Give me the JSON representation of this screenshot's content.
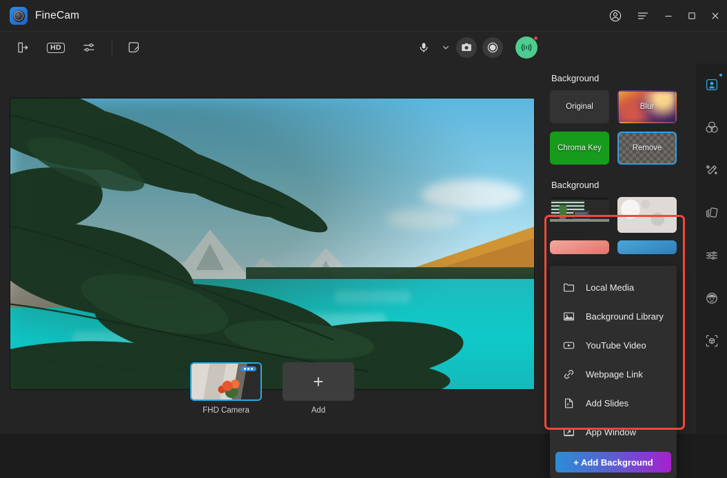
{
  "app": {
    "name": "FineCam"
  },
  "titlebar": {
    "buttons": [
      {
        "name": "account-icon",
        "label": "Account"
      },
      {
        "name": "menu-icon",
        "label": "Menu"
      },
      {
        "name": "minimize-icon",
        "label": "Minimize"
      },
      {
        "name": "maximize-icon",
        "label": "Maximize"
      },
      {
        "name": "close-icon",
        "label": "Close"
      }
    ]
  },
  "toolbar": {
    "left": [
      {
        "name": "output-icon",
        "label": "Virtual Camera Output"
      },
      {
        "name": "hd-badge",
        "label": "HD"
      },
      {
        "name": "adjust-icon",
        "label": "Adjustments"
      },
      {
        "name": "whiteboard-icon",
        "label": "Whiteboard"
      }
    ],
    "right": [
      {
        "name": "microphone-icon",
        "label": "Microphone"
      },
      {
        "name": "chevron-down-icon",
        "label": "Microphone Options"
      },
      {
        "name": "snapshot-icon",
        "label": "Snapshot"
      },
      {
        "name": "record-icon",
        "label": "Record"
      },
      {
        "name": "broadcast-icon",
        "label": "Live"
      }
    ]
  },
  "cameras": {
    "items": [
      {
        "label": "FHD Camera",
        "selected": true,
        "badge": "..."
      },
      {
        "label": "Add",
        "selected": false,
        "badge": ""
      }
    ]
  },
  "panel": {
    "background_title": "Background",
    "modes": [
      {
        "label": "Original",
        "style": "original",
        "selected": false
      },
      {
        "label": "Blur",
        "style": "blur",
        "selected": false
      },
      {
        "label": "Chroma Key",
        "style": "chroma",
        "selected": false
      },
      {
        "label": "Remove",
        "style": "remove",
        "selected": true
      }
    ],
    "library_title": "Background",
    "thumbnails": [
      {
        "name": "background-thumb-office",
        "label": "Office Desk"
      },
      {
        "name": "background-thumb-wall",
        "label": "White Wall"
      },
      {
        "name": "background-thumb-pink",
        "label": "Pink"
      },
      {
        "name": "background-thumb-blue",
        "label": "Blue"
      }
    ]
  },
  "menu": {
    "items": [
      {
        "icon": "folder-icon",
        "label": "Local Media"
      },
      {
        "icon": "image-icon",
        "label": "Background Library"
      },
      {
        "icon": "youtube-icon",
        "label": "YouTube Video"
      },
      {
        "icon": "link-icon",
        "label": "Webpage Link"
      },
      {
        "icon": "slides-icon",
        "label": "Add Slides"
      },
      {
        "icon": "app-window-icon",
        "label": "App Window"
      }
    ],
    "add_button": "+ Add Background"
  },
  "rail": {
    "items": [
      {
        "name": "portrait-icon",
        "label": "Background",
        "active": true
      },
      {
        "name": "filters-icon",
        "label": "Filters",
        "active": false
      },
      {
        "name": "effects-icon",
        "label": "Effects",
        "active": false
      },
      {
        "name": "layers-icon",
        "label": "Layers",
        "active": false
      },
      {
        "name": "sliders-icon",
        "label": "Adjust",
        "active": false
      },
      {
        "name": "avatar-icon",
        "label": "Avatar",
        "active": false
      },
      {
        "name": "ar-icon",
        "label": "AR Objects",
        "active": false
      }
    ]
  },
  "colors": {
    "accent": "#29abe2",
    "live": "#4ecb8f",
    "chroma": "#179b1c",
    "highlight": "#f0493c",
    "gradient_start": "#2b8ed6",
    "gradient_end": "#a521cd"
  },
  "preview": {
    "scene": "Mountain lake with pine branches"
  }
}
